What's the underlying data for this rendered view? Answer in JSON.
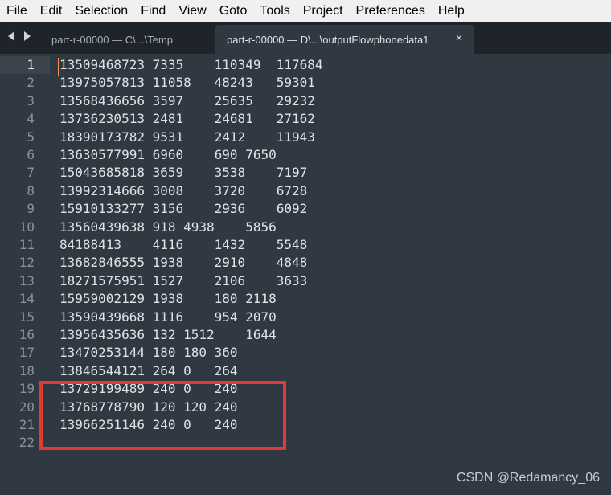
{
  "menu": [
    "File",
    "Edit",
    "Selection",
    "Find",
    "View",
    "Goto",
    "Tools",
    "Project",
    "Preferences",
    "Help"
  ],
  "tabs": [
    {
      "label": "part-r-00000 — C\\...\\Temp",
      "active": false
    },
    {
      "label": "part-r-00000 — D\\...\\outputFlowphonedata1",
      "active": true
    }
  ],
  "tab_close_glyph": "×",
  "editor": {
    "active_line": 1,
    "lines": [
      "13509468723 7335    110349  117684",
      "13975057813 11058   48243   59301",
      "13568436656 3597    25635   29232",
      "13736230513 2481    24681   27162",
      "18390173782 9531    2412    11943",
      "13630577991 6960    690 7650",
      "15043685818 3659    3538    7197",
      "13992314666 3008    3720    6728",
      "15910133277 3156    2936    6092",
      "13560439638 918 4938    5856",
      "84188413    4116    1432    5548",
      "13682846555 1938    2910    4848",
      "18271575951 1527    2106    3633",
      "15959002129 1938    180 2118",
      "13590439668 1116    954 2070",
      "13956435636 132 1512    1644",
      "13470253144 180 180 360",
      "13846544121 264 0   264",
      "13729199489 240 0   240",
      "13768778790 120 120 240",
      "13966251146 240 0   240",
      ""
    ]
  },
  "highlight": {
    "from_line": 19,
    "to_line": 21,
    "color": "#e53935"
  },
  "watermark": "CSDN @Redamancy_06",
  "colors": {
    "editor_bg": "#303841",
    "tabbar_bg": "#1f242a",
    "menubar_bg": "#f0f0f0",
    "text": "#dfe3e7",
    "gutter_text": "#8a939c",
    "caret": "#f99157"
  }
}
